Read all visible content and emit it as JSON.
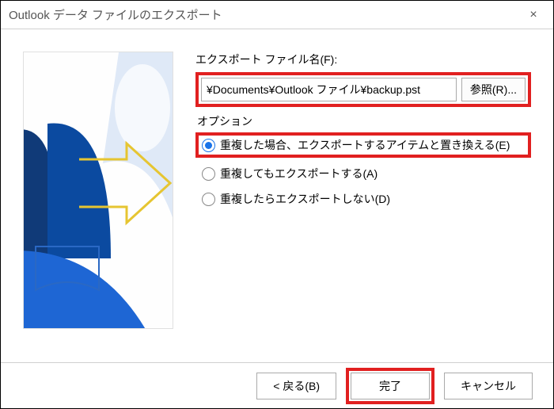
{
  "title": "Outlook データ ファイルのエクスポート",
  "close": "×",
  "export": {
    "file_label": "エクスポート ファイル名(F):",
    "file_path": "¥Documents¥Outlook ファイル¥backup.pst",
    "browse": "参照(R)..."
  },
  "options": {
    "group_label": "オプション",
    "items": [
      {
        "label": "重複した場合、エクスポートするアイテムと置き換える(E)",
        "checked": true
      },
      {
        "label": "重複してもエクスポートする(A)",
        "checked": false
      },
      {
        "label": "重複したらエクスポートしない(D)",
        "checked": false
      }
    ]
  },
  "buttons": {
    "back": "< 戻る(B)",
    "finish": "完了",
    "cancel": "キャンセル"
  }
}
